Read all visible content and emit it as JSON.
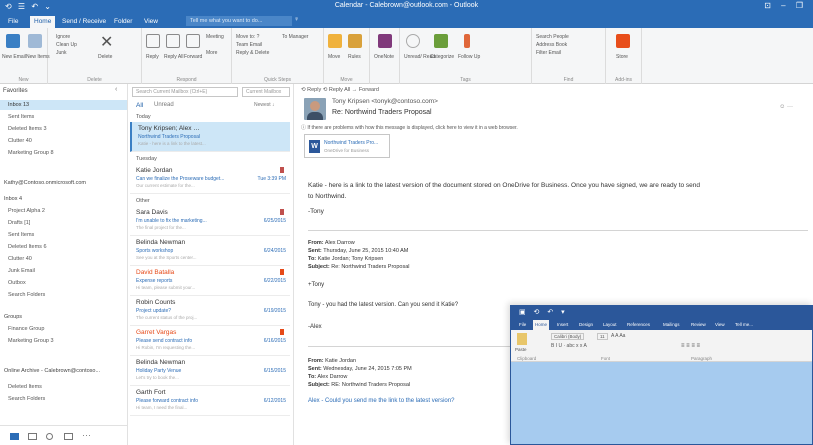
{
  "window": {
    "title": "Calendar - Calebrown@outlook.com - Outlook",
    "controls": "⊡ – ❐"
  },
  "quick_access": "⟲ ☰ ↶ ⌄",
  "tabs": [
    {
      "label": "File"
    },
    {
      "label": "Home"
    },
    {
      "label": "Send / Receive"
    },
    {
      "label": "Folder"
    },
    {
      "label": "View"
    }
  ],
  "tell_me": {
    "placeholder": "Tell me what you want to do..."
  },
  "ribbon": {
    "groups": [
      {
        "label": "New"
      },
      {
        "label": "Delete"
      },
      {
        "label": "Respond"
      },
      {
        "label": "Quick Steps"
      },
      {
        "label": "Move"
      },
      {
        "label": "Tags"
      },
      {
        "label": "Find"
      },
      {
        "label": "Add-ins"
      }
    ],
    "new_email": "New Email",
    "new_items": "New Items",
    "ignore": "Ignore",
    "clean_up": "Clean Up",
    "junk": "Junk",
    "delete": "Delete",
    "reply": "Reply",
    "reply_all": "Reply All",
    "forward": "Forward",
    "meeting": "Meeting",
    "more": "More",
    "move_to": "Move to: ?",
    "to_manager": "To Manager",
    "team_email": "Team Email",
    "reply_delete": "Reply & Delete",
    "move": "Move",
    "rules": "Rules",
    "onenote": "OneNote",
    "unread_read": "Unread/ Read",
    "categorize": "Categorize",
    "follow_up": "Follow Up",
    "search_people": "Search People",
    "address_book": "Address Book",
    "filter_email": "Filter Email",
    "store": "Store"
  },
  "nav": {
    "favorites": "Favorites",
    "collapse": "‹",
    "items": [
      {
        "label": "Inbox 13",
        "selected": true
      },
      {
        "label": "Sent Items"
      },
      {
        "label": "Deleted Items 3"
      },
      {
        "label": "Clutter 40"
      },
      {
        "label": "Marketing Group 8"
      },
      {
        "label": "Kathy@Contoso.onmicrosoft.com",
        "group": true
      },
      {
        "label": "Inbox 4",
        "group": true
      },
      {
        "label": "Project Alpha 2"
      },
      {
        "label": "Drafts [1]"
      },
      {
        "label": "Sent Items"
      },
      {
        "label": "Deleted Items 6"
      },
      {
        "label": "Clutter 40"
      },
      {
        "label": "Junk Email"
      },
      {
        "label": "Outbox"
      },
      {
        "label": "Search Folders"
      },
      {
        "label": "Groups",
        "group": true
      },
      {
        "label": "Finance Group"
      },
      {
        "label": "Marketing Group 3"
      },
      {
        "label": "Online Archive - Calebrown@contoso...",
        "group": true
      },
      {
        "label": "Deleted Items"
      },
      {
        "label": "Search Folders"
      }
    ],
    "bottom_more": "···"
  },
  "list": {
    "search_placeholder": "Search Current Mailbox (Ctrl+E)",
    "mailbox_scope": "Current Mailbox",
    "filter_all": "All",
    "filter_unread": "Unread",
    "sort": "Newest ↓",
    "groups": [
      {
        "label": "Today"
      },
      {
        "label": "Tuesday"
      },
      {
        "label": "Other"
      }
    ],
    "messages": [
      {
        "sender": "Tony Kripsen; Alex …",
        "subject": "Northwind Traders Proposal",
        "preview": "Katie - here is a link to the latest...",
        "date": "",
        "selected": true,
        "flag": ""
      },
      {
        "sender": "Katie Jordan",
        "subject": "Can we finalize the Proseware budget...",
        "preview": "Our current estimate for the...",
        "date": "Tue 3:39 PM",
        "flag": "#c0504d"
      },
      {
        "sender": "Sara Davis",
        "subject": "I'm unable to fix the marketing...",
        "preview": "The final project for the...",
        "date": "6/25/2015",
        "flag": "#c0504d"
      },
      {
        "sender": "Belinda Newman",
        "subject": "Sports workshop",
        "preview": "See you at the Sports center...",
        "date": "6/24/2015",
        "flag": ""
      },
      {
        "sender": "David Batalla",
        "subject": "Expense reports",
        "preview": "Hi team, please submit your...",
        "date": "6/22/2015",
        "flag": "#e64a19",
        "sender_color": "#e64a19"
      },
      {
        "sender": "Robin Counts",
        "subject": "Project update?",
        "preview": "The current status of the proj...",
        "date": "6/19/2015",
        "flag": ""
      },
      {
        "sender": "Garret Vargas",
        "subject": "Please send contract info",
        "preview": "Hi Robin, I'm requesting the...",
        "date": "6/16/2015",
        "flag": "#e64a19",
        "sender_color": "#e64a19"
      },
      {
        "sender": "Belinda Newman",
        "subject": "Holiday Party Venue",
        "preview": "Let's try to book the...",
        "date": "6/15/2015",
        "flag": ""
      },
      {
        "sender": "Garth Fort",
        "subject": "Please forward contract info",
        "preview": "Hi team, I need the final...",
        "date": "6/12/2015",
        "flag": ""
      }
    ]
  },
  "reading": {
    "actions": "⟲ Reply  ⟲ Reply All  → Forward",
    "sender": "Tony Kripsen  <tonyk@contoso.com>",
    "subject": "Re: Northwind Traders Proposal",
    "info": "ⓘ If there are problems with how this message is displayed, click here to view it in a web browser.",
    "attachment_name": "Northwind Traders Pro...",
    "attachment_sub": "OneDrive for Business",
    "tools": "☺  ···",
    "body": [
      "Katie - here is a link to the latest version of the document stored on OneDrive for Business. Once you have signed, we are ready to send",
      "to Northwind.",
      "-Tony"
    ],
    "quoted1": {
      "from": "Alex Darrow",
      "sent": "Thursday, June 25, 2015 10:40 AM",
      "to": "Katie Jordan; Tony Kripsen",
      "subject": "Re: Northwind Traders Proposal",
      "body": [
        "+Tony",
        "Tony - you had the latest version. Can you send it Katie?",
        "-Alex"
      ]
    },
    "quoted2": {
      "from": "Katie Jordan",
      "sent": "Wednesday, June 24, 2015 7:05 PM",
      "to": "Alex Darrow",
      "subject": "RE: Northwind Traders Proposal",
      "body": [
        "Alex - Could you send me the link to the latest version?"
      ]
    },
    "labels": {
      "from": "From:",
      "sent": "Sent:",
      "to": "To:",
      "subject": "Subject:"
    }
  },
  "word": {
    "qa": "▣ ⟲ ↶ ▾",
    "tabs": [
      {
        "label": "File"
      },
      {
        "label": "Home"
      },
      {
        "label": "Insert"
      },
      {
        "label": "Design"
      },
      {
        "label": "Layout"
      },
      {
        "label": "References"
      },
      {
        "label": "Mailings"
      },
      {
        "label": "Review"
      },
      {
        "label": "View"
      },
      {
        "label": "Tell me..."
      }
    ],
    "font_name": "Calibri (Body)",
    "font_size": "11",
    "font_row": "A A Aa",
    "format_row": "B I U · abc x x A",
    "para_row": "≡ ≡ ≡ ≡",
    "paste": "Paste",
    "groups": [
      {
        "label": "Clipboard"
      },
      {
        "label": "Font"
      },
      {
        "label": "Paragraph"
      }
    ]
  },
  "colors": {
    "outlook_blue": "#2b6cb6",
    "word_blue": "#2b579a",
    "selection": "#cde6f7",
    "flag_red": "#c0504d",
    "word_canvas": "#a6cbef"
  }
}
